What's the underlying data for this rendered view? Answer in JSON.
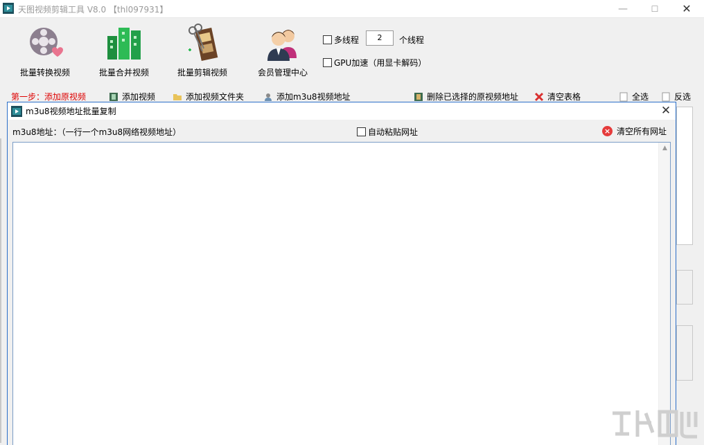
{
  "window": {
    "title": "天图视频剪辑工具 V8.0 【thl097931】",
    "min_glyph": "—",
    "max_glyph": "☐",
    "close_glyph": "✕"
  },
  "toolbar": {
    "items": [
      {
        "label": "批量转换视频",
        "icon": "film-reel-heart-icon"
      },
      {
        "label": "批量合并视频",
        "icon": "merge-blocks-icon"
      },
      {
        "label": "批量剪辑视频",
        "icon": "film-scissors-icon"
      },
      {
        "label": "会员管理中心",
        "icon": "members-icon"
      }
    ],
    "multithread_label": "多线程",
    "thread_count": "2",
    "thread_unit": "个线程",
    "gpu_label": "GPU加速（用显卡解码）"
  },
  "steps": {
    "step_label": "第一步：添加原视频",
    "add_video": "添加视频",
    "add_folder": "添加视频文件夹",
    "add_m3u8": "添加m3u8视频地址",
    "delete_selected": "删除已选择的原视频地址",
    "clear_table": "清空表格",
    "select_all": "全选",
    "invert": "反选"
  },
  "dialog": {
    "title": "m3u8视频地址批量复制",
    "close_glyph": "✕",
    "input_label": "m3u8地址：（一行一个m3u8网络视频地址）",
    "auto_paste_label": "自动粘贴网址",
    "clear_all_label": "清空所有网址",
    "textarea_value": "",
    "scroll_up": "▲"
  },
  "colors": {
    "accent": "#2a6ec8",
    "step_red": "#dd0000",
    "clear_red": "#e53b3b"
  }
}
